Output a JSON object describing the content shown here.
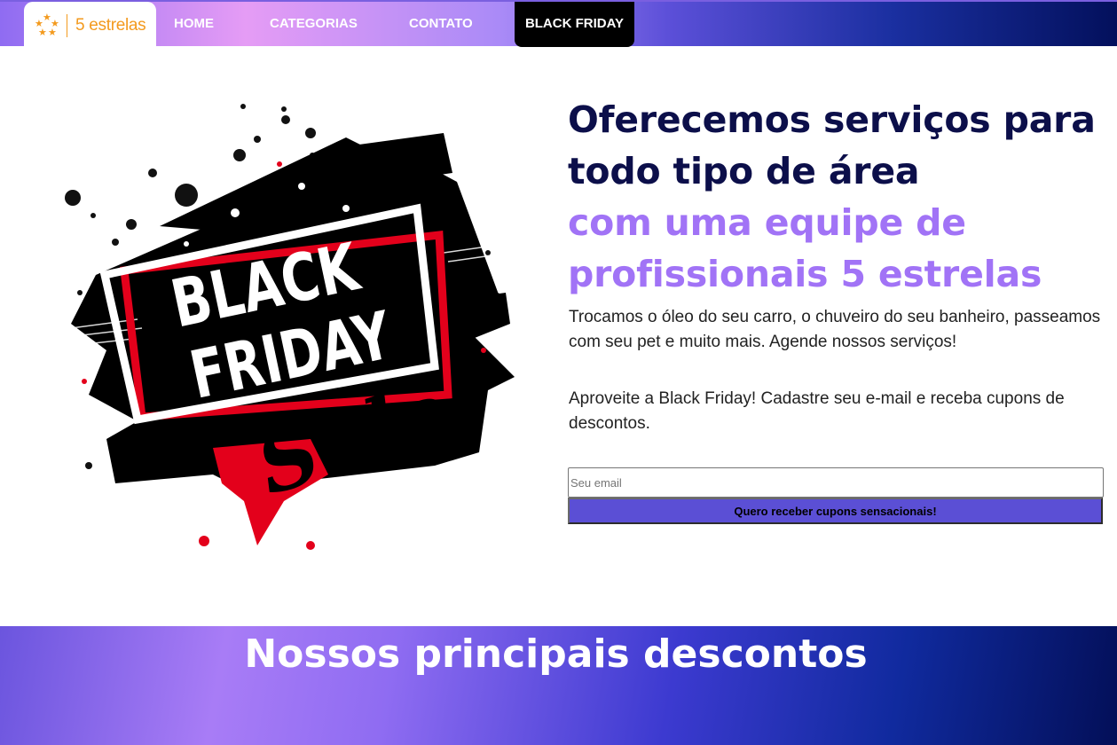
{
  "nav": {
    "logo_text": "5 estrelas",
    "links": [
      "HOME",
      "CATEGORIAS",
      "CONTATO"
    ],
    "cta": "BLACK FRIDAY"
  },
  "hero": {
    "image_text": {
      "line1": "BLACK",
      "line2": "FRIDAY",
      "line3": "Sale"
    },
    "headline_dark": "Oferecemos serviços para todo tipo de área",
    "headline_accent": "com uma equipe de profissionais 5 estrelas",
    "paragraph1": "Trocamos o óleo do seu carro, o chuveiro do seu banheiro, passeamos com seu pet e muito mais. Agende nossos serviços!",
    "paragraph2": "Aproveite a Black Friday! Cadastre seu e-mail e receba cupons de descontos.",
    "email_placeholder": "Seu email",
    "submit_label": "Quero receber cupons sensacionais!"
  },
  "section": {
    "title": "Nossos principais descontos"
  },
  "colors": {
    "accent_purple": "#a173f6",
    "dark_navy": "#0c0f4a",
    "logo_orange": "#f39a1e",
    "button": "#5b4fd5"
  }
}
